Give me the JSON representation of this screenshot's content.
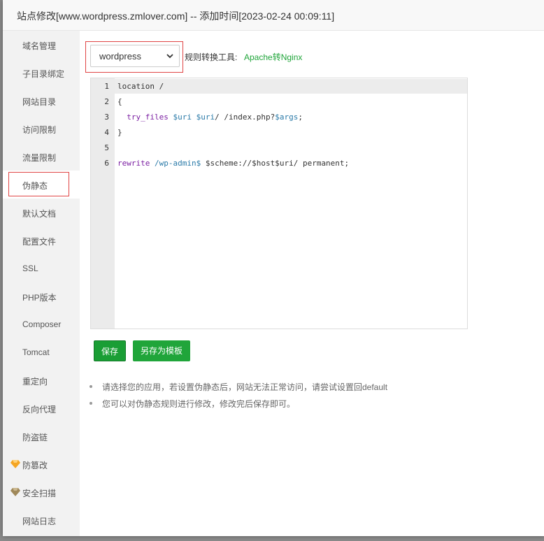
{
  "dialog": {
    "title": "站点修改[www.wordpress.zmlover.com] -- 添加时间[2023-02-24 00:09:11]"
  },
  "sidebar": {
    "items": [
      {
        "label": "域名管理"
      },
      {
        "label": "子目录绑定"
      },
      {
        "label": "网站目录"
      },
      {
        "label": "访问限制"
      },
      {
        "label": "流量限制"
      },
      {
        "label": "伪静态"
      },
      {
        "label": "默认文档"
      },
      {
        "label": "配置文件"
      },
      {
        "label": "SSL"
      },
      {
        "label": "PHP版本"
      },
      {
        "label": "Composer"
      },
      {
        "label": "Tomcat"
      },
      {
        "label": "重定向"
      },
      {
        "label": "反向代理"
      },
      {
        "label": "防盗链"
      },
      {
        "label": "防篡改",
        "icon": "gold-diamond-icon"
      },
      {
        "label": "安全扫描",
        "icon": "bronze-diamond-icon"
      },
      {
        "label": "网站日志"
      }
    ],
    "active_index": 5
  },
  "rewrite": {
    "selected_template": "wordpress",
    "tool_label": "规则转换工具:",
    "tool_link": "Apache转Nginx"
  },
  "editor": {
    "line_numbers": [
      "1",
      "2",
      "3",
      "4",
      "5",
      "6"
    ],
    "code": {
      "l1": "location /",
      "l2": "{",
      "l3_fn": "try_files",
      "l3_v1": "$uri",
      "l3_v2": "$uri",
      "l3_rest": "/ /index.php?",
      "l3_v3": "$args",
      "l3_end": ";",
      "l4": "}",
      "l6_kw": "rewrite",
      "l6_str": "/wp-admin$",
      "l6_a": "$scheme://",
      "l6_v1": "$host",
      "l6_v2": "$uri",
      "l6_end": "/ permanent;"
    }
  },
  "buttons": {
    "save": "保存",
    "save_as_template": "另存为模板"
  },
  "tips": [
    "请选择您的应用，若设置伪静态后，网站无法正常访问，请尝试设置回default",
    "您可以对伪静态规则进行修改，修改完后保存即可。"
  ],
  "colors": {
    "accent_green": "#20a53a",
    "highlight_red": "#e04545",
    "gold_diamond": "#f5a623",
    "bronze_diamond": "#a0895a"
  }
}
